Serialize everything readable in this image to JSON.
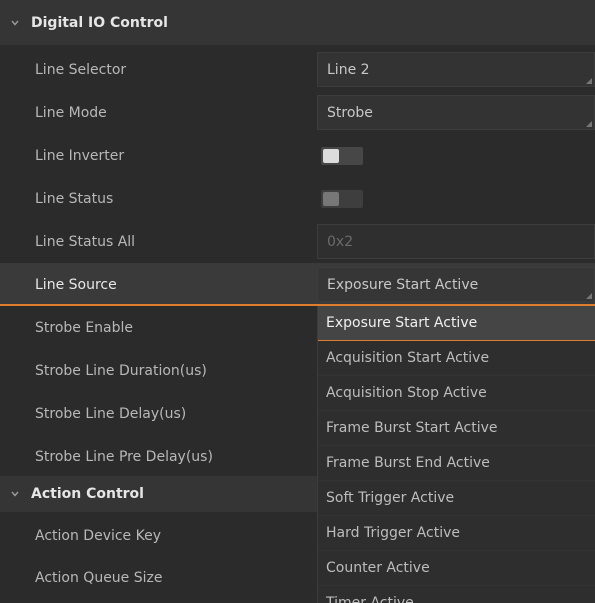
{
  "groups": {
    "digital_io": "Digital IO Control",
    "action": "Action Control"
  },
  "rows": {
    "line_selector": {
      "label": "Line Selector",
      "value": "Line 2"
    },
    "line_mode": {
      "label": "Line Mode",
      "value": "Strobe"
    },
    "line_inverter": {
      "label": "Line Inverter",
      "state": "off"
    },
    "line_status": {
      "label": "Line Status",
      "state": "off"
    },
    "line_status_all": {
      "label": "Line Status All",
      "value": "0x2"
    },
    "line_source": {
      "label": "Line Source",
      "value": "Exposure Start Active"
    },
    "strobe_enable": {
      "label": "Strobe Enable"
    },
    "strobe_duration": {
      "label": "Strobe Line Duration(us)"
    },
    "strobe_delay": {
      "label": "Strobe Line Delay(us)"
    },
    "strobe_pre_delay": {
      "label": "Strobe Line Pre Delay(us)"
    },
    "action_device_key": {
      "label": "Action Device Key"
    },
    "action_queue_size": {
      "label": "Action Queue Size"
    }
  },
  "dropdown": {
    "options": [
      "Exposure Start Active",
      "Acquisition Start Active",
      "Acquisition Stop Active",
      "Frame Burst Start Active",
      "Frame Burst End Active",
      "Soft Trigger Active",
      "Hard Trigger Active",
      "Counter Active",
      "Timer Active"
    ],
    "selected": "Exposure Start Active"
  },
  "colors": {
    "accent": "#e07d2c",
    "background": "#2b2b2b"
  }
}
